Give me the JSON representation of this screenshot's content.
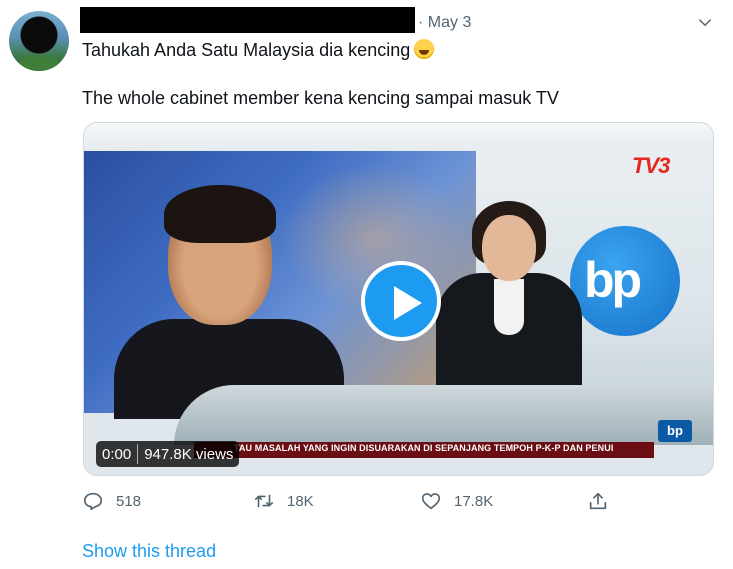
{
  "tweet": {
    "date": "· May 3",
    "line1": "Tahukah Anda Satu Malaysia dia kencing",
    "line2": "The whole cabinet member kena kencing sampai masuk TV"
  },
  "video": {
    "channel_logo": "TV3",
    "studio_logo": "bp",
    "ticker_logo": "bp",
    "ticker_text": "TAU MASALAH YANG INGIN DISUARAKAN DI SEPANJANG TEMPOH P-K-P DAN PENUI",
    "time": "0:00",
    "views": "947.8K views"
  },
  "actions": {
    "reply_count": "518",
    "retweet_count": "18K",
    "like_count": "17.8K"
  },
  "thread_link": "Show this thread",
  "icons": [
    "avatar",
    "chevron-down-icon",
    "emoji-icon",
    "play-icon",
    "reply-icon",
    "retweet-icon",
    "like-icon",
    "share-icon"
  ],
  "colors": {
    "accent": "#1d9bf0",
    "muted": "#536471",
    "text": "#0f1419"
  }
}
